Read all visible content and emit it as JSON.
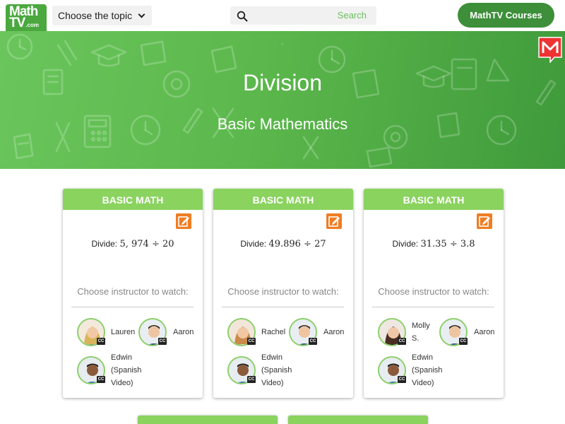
{
  "header": {
    "logo_line1": "Math",
    "logo_line2": "TV",
    "logo_line3": ".com",
    "topic_label": "Choose the topic",
    "search_placeholder": "",
    "search_button": "Search",
    "courses_label": "MathTV Courses"
  },
  "hero": {
    "title": "Division",
    "subtitle": "Basic Mathematics"
  },
  "cards": [
    {
      "category": "BASIC MATH",
      "prefix": "Divide:",
      "math": "5, 974 ÷ 20",
      "choose": "Choose instructor to watch:",
      "instructors": [
        {
          "name": "Lauren",
          "cc": "CC"
        },
        {
          "name": "Aaron",
          "cc": "CC"
        },
        {
          "name_l1": "Edwin",
          "name_l2": "(Spanish",
          "name_l3": "Video)",
          "cc": "CC"
        }
      ]
    },
    {
      "category": "BASIC MATH",
      "prefix": "Divide:",
      "math": "49.896 ÷ 27",
      "choose": "Choose instructor to watch:",
      "instructors": [
        {
          "name": "Rachel",
          "cc": "CC"
        },
        {
          "name": "Aaron",
          "cc": "CC"
        },
        {
          "name_l1": "Edwin",
          "name_l2": "(Spanish",
          "name_l3": "Video)",
          "cc": "CC"
        }
      ]
    },
    {
      "category": "BASIC MATH",
      "prefix": "Divide:",
      "math": "31.35 ÷ 3.8",
      "choose": "Choose instructor to watch:",
      "instructors": [
        {
          "name_l1": "Molly",
          "name_l2": "S.",
          "cc": "CC"
        },
        {
          "name": "Aaron",
          "cc": "CC"
        },
        {
          "name_l1": "Edwin",
          "name_l2": "(Spanish",
          "name_l3": "Video)",
          "cc": "CC"
        }
      ]
    }
  ],
  "colors": {
    "brand_green": "#4aa83f",
    "header_card": "#8ad35f",
    "course_button": "#3d8f3a",
    "edit_icon": "#ef7d22"
  }
}
